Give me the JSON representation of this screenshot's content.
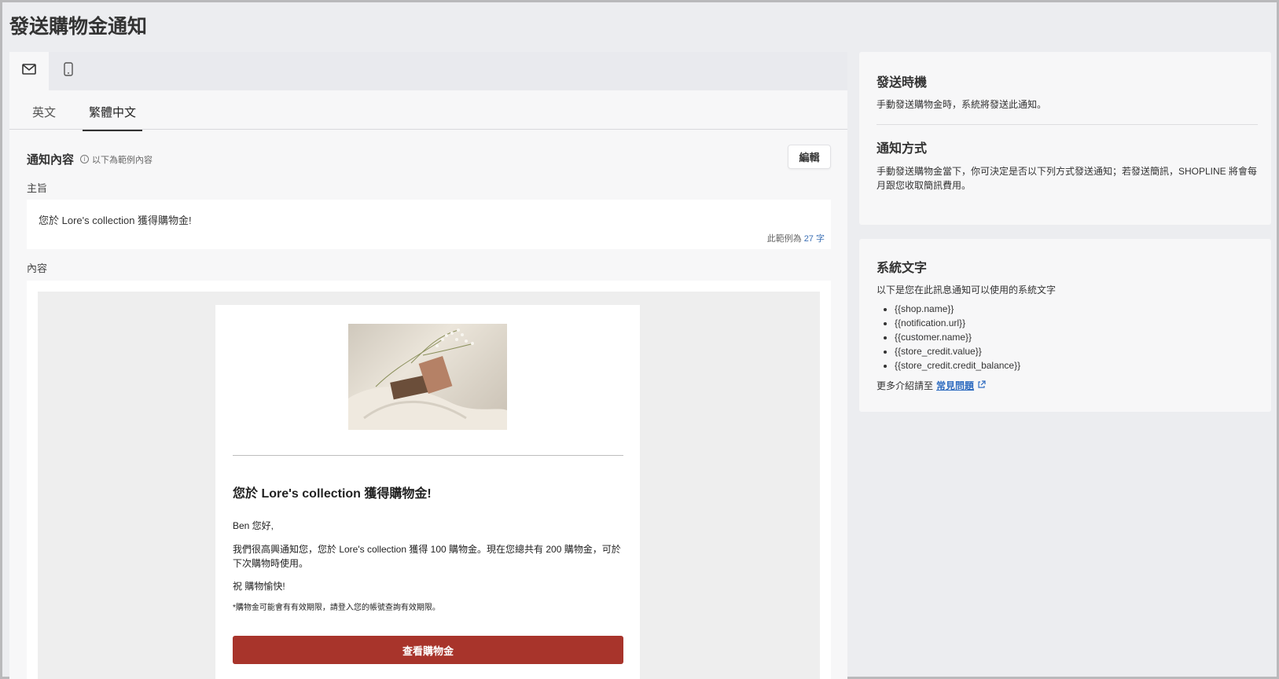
{
  "page": {
    "title": "發送購物金通知"
  },
  "channels": [
    {
      "name": "email",
      "icon": "mail-icon",
      "active": true
    },
    {
      "name": "mobile",
      "icon": "mobile-icon",
      "active": false
    }
  ],
  "language_tabs": [
    {
      "label": "英文",
      "active": false
    },
    {
      "label": "繁體中文",
      "active": true
    }
  ],
  "notification": {
    "section_title": "通知內容",
    "sample_note": "以下為範例內容",
    "edit_label": "編輯",
    "subject_label": "主旨",
    "subject_value": "您於 Lore's collection 獲得購物金!",
    "char_count_prefix": "此範例為",
    "char_count_value": "27",
    "char_count_suffix": "字",
    "content_label": "內容"
  },
  "email_preview": {
    "heading": "您於 Lore's collection 獲得購物金!",
    "greeting": "Ben 您好,",
    "body": "我們很高興通知您，您於 Lore's collection 獲得 100 購物金。現在您總共有 200 購物金，可於下次購物時使用。",
    "closing": "祝 購物愉快!",
    "footnote": "*購物金可能會有有效期限，請登入您的帳號查詢有效期限。",
    "cta_label": "查看購物金",
    "cta_color": "#a8342b"
  },
  "timing_card": {
    "title": "發送時機",
    "text": "手動發送購物金時，系統將發送此通知。",
    "method_title": "通知方式",
    "method_text": "手動發送購物金當下，你可決定是否以下列方式發送通知；若發送簡訊，SHOPLINE 將會每月跟您收取簡訊費用。"
  },
  "system_vars_card": {
    "title": "系統文字",
    "intro": "以下是您在此訊息通知可以使用的系統文字",
    "variables": [
      "{{shop.name}}",
      "{{notification.url}}",
      "{{customer.name}}",
      "{{store_credit.value}}",
      "{{store_credit.credit_balance}}"
    ],
    "faq_prefix": "更多介紹請至",
    "faq_link": "常見問題"
  }
}
